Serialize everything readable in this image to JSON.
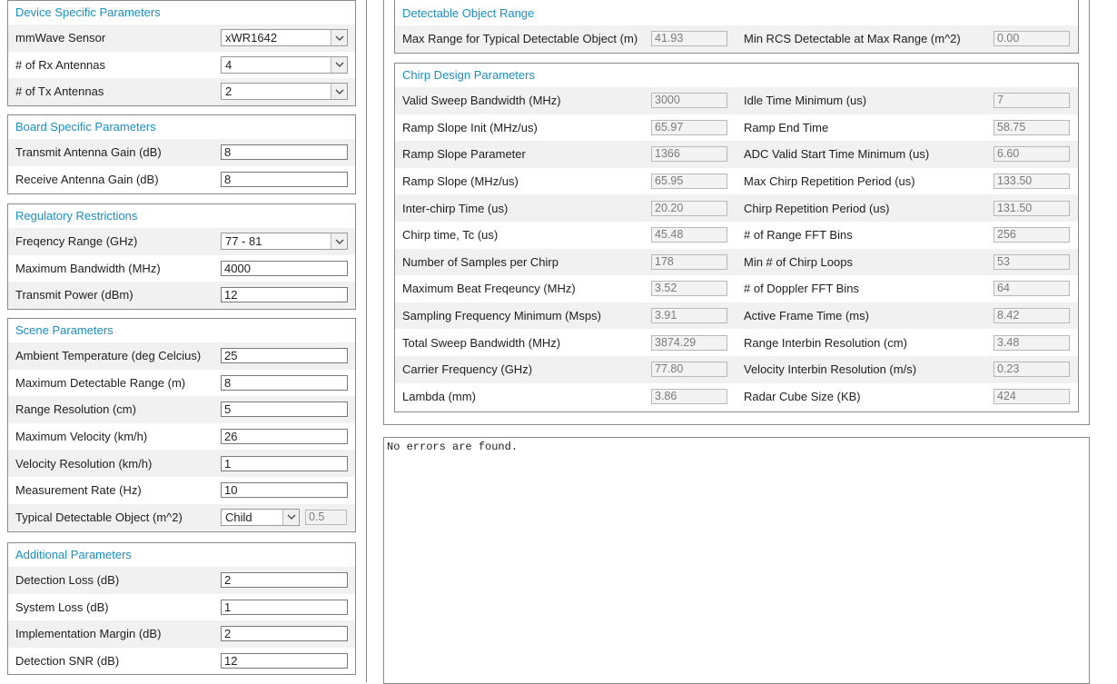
{
  "device": {
    "title": "Device Specific Parameters",
    "mmwave_sensor": {
      "label": "mmWave Sensor",
      "value": "xWR1642"
    },
    "rx_antennas": {
      "label": "# of Rx Antennas",
      "value": "4"
    },
    "tx_antennas": {
      "label": "# of Tx Antennas",
      "value": "2"
    }
  },
  "board": {
    "title": "Board Specific Parameters",
    "tx_gain": {
      "label": "Transmit Antenna Gain (dB)",
      "value": "8"
    },
    "rx_gain": {
      "label": "Receive Antenna Gain (dB)",
      "value": "8"
    }
  },
  "regulatory": {
    "title": "Regulatory Restrictions",
    "freq_range": {
      "label": "Freqency Range (GHz)",
      "value": "77 - 81"
    },
    "max_bw": {
      "label": "Maximum Bandwidth (MHz)",
      "value": "4000"
    },
    "tx_power": {
      "label": "Transmit Power (dBm)",
      "value": "12"
    }
  },
  "scene": {
    "title": "Scene Parameters",
    "ambient_temp": {
      "label": "Ambient Temperature (deg Celcius)",
      "value": "25"
    },
    "max_range": {
      "label": "Maximum Detectable Range (m)",
      "value": "8"
    },
    "range_res": {
      "label": "Range Resolution (cm)",
      "value": "5"
    },
    "max_vel": {
      "label": "Maximum Velocity (km/h)",
      "value": "26"
    },
    "vel_res": {
      "label": "Velocity Resolution (km/h)",
      "value": "1"
    },
    "meas_rate": {
      "label": "Measurement Rate (Hz)",
      "value": "10"
    },
    "typ_object": {
      "label": "Typical Detectable Object (m^2)",
      "value": "Child",
      "rcs": "0.5"
    }
  },
  "additional": {
    "title": "Additional Parameters",
    "det_loss": {
      "label": "Detection Loss (dB)",
      "value": "2"
    },
    "sys_loss": {
      "label": "System Loss (dB)",
      "value": "1"
    },
    "impl_margin": {
      "label": "Implementation Margin (dB)",
      "value": "2"
    },
    "det_snr": {
      "label": "Detection SNR (dB)",
      "value": "12"
    }
  },
  "detectable": {
    "title": "Detectable Object Range",
    "max_range_label": "Max Range for Typical Detectable Object (m)",
    "max_range_value": "41.93",
    "min_rcs_label": "Min RCS Detectable at Max Range (m^2)",
    "min_rcs_value": "0.00"
  },
  "chirp": {
    "title": "Chirp Design Parameters",
    "rows": [
      {
        "l1": "Valid Sweep Bandwidth (MHz)",
        "v1": "3000",
        "l2": "Idle Time Minimum (us)",
        "v2": "7"
      },
      {
        "l1": "Ramp Slope Init (MHz/us)",
        "v1": "65.97",
        "l2": "Ramp End Time",
        "v2": "58.75"
      },
      {
        "l1": "Ramp Slope Parameter",
        "v1": "1366",
        "l2": "ADC Valid Start Time Minimum (us)",
        "v2": "6.60"
      },
      {
        "l1": "Ramp Slope (MHz/us)",
        "v1": "65.95",
        "l2": "Max Chirp Repetition Period (us)",
        "v2": "133.50"
      },
      {
        "l1": "Inter-chirp Time (us)",
        "v1": "20.20",
        "l2": "Chirp Repetition Period (us)",
        "v2": "131.50"
      },
      {
        "l1": "Chirp time, Tc (us)",
        "v1": "45.48",
        "l2": "# of Range FFT Bins",
        "v2": "256"
      },
      {
        "l1": "Number of Samples per Chirp",
        "v1": "178",
        "l2": "Min # of Chirp Loops",
        "v2": "53"
      },
      {
        "l1": "Maximum Beat Freqeuncy (MHz)",
        "v1": "3.52",
        "l2": "# of Doppler FFT Bins",
        "v2": "64"
      },
      {
        "l1": "Sampling Frequency Minimum (Msps)",
        "v1": "3.91",
        "l2": "Active Frame Time (ms)",
        "v2": "8.42"
      },
      {
        "l1": "Total Sweep Bandwidth (MHz)",
        "v1": "3874.29",
        "l2": "Range Interbin Resolution (cm)",
        "v2": "3.48"
      },
      {
        "l1": "Carrier Frequency (GHz)",
        "v1": "77.80",
        "l2": "Velocity Interbin Resolution (m/s)",
        "v2": "0.23"
      },
      {
        "l1": "Lambda (mm)",
        "v1": "3.86",
        "l2": "Radar Cube Size (KB)",
        "v2": "424"
      }
    ]
  },
  "console": {
    "text": "No errors are found."
  }
}
